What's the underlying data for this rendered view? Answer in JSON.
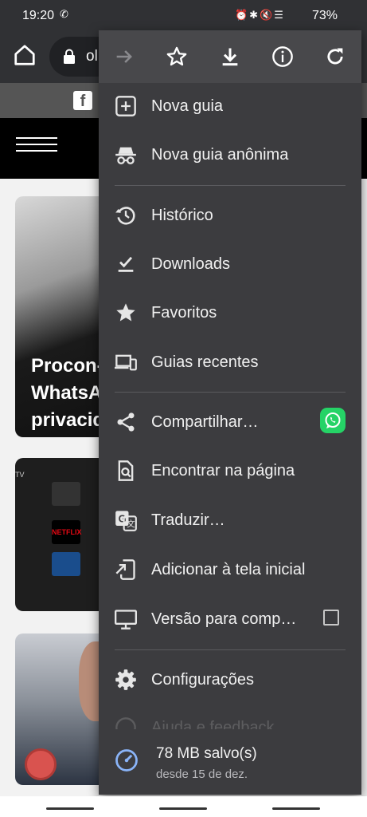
{
  "status_bar": {
    "time": "19:20",
    "battery": "73%"
  },
  "browser": {
    "url_fragment": "ol"
  },
  "article": {
    "title_lines": [
      "Procon-",
      "WhatsA",
      "privacid"
    ],
    "tv_app_label": "NETFLIX"
  },
  "menu": {
    "items": [
      {
        "label": "Nova guia",
        "icon": "add-tab-icon"
      },
      {
        "label": "Nova guia anônima",
        "icon": "incognito-icon"
      },
      {
        "label": "Histórico",
        "icon": "history-icon"
      },
      {
        "label": "Downloads",
        "icon": "downloads-check-icon"
      },
      {
        "label": "Favoritos",
        "icon": "star-filled-icon"
      },
      {
        "label": "Guias recentes",
        "icon": "devices-icon"
      },
      {
        "label": "Compartilhar…",
        "icon": "share-icon"
      },
      {
        "label": "Encontrar na página",
        "icon": "find-in-page-icon"
      },
      {
        "label": "Traduzir…",
        "icon": "translate-icon"
      },
      {
        "label": "Adicionar à tela inicial",
        "icon": "add-to-home-icon"
      },
      {
        "label": "Versão para comp…",
        "icon": "desktop-icon"
      },
      {
        "label": "Configurações",
        "icon": "settings-icon"
      },
      {
        "label": "Ajuda e feedback",
        "icon": "help-icon"
      }
    ],
    "desktop_site_checked": false,
    "data_saved": {
      "amount": "78 MB salvo(s)",
      "since": "desde 15 de dez."
    }
  },
  "colors": {
    "menu_bg": "#3c3c3f",
    "whatsapp": "#25d366",
    "saver_accent": "#8ab4f8"
  }
}
